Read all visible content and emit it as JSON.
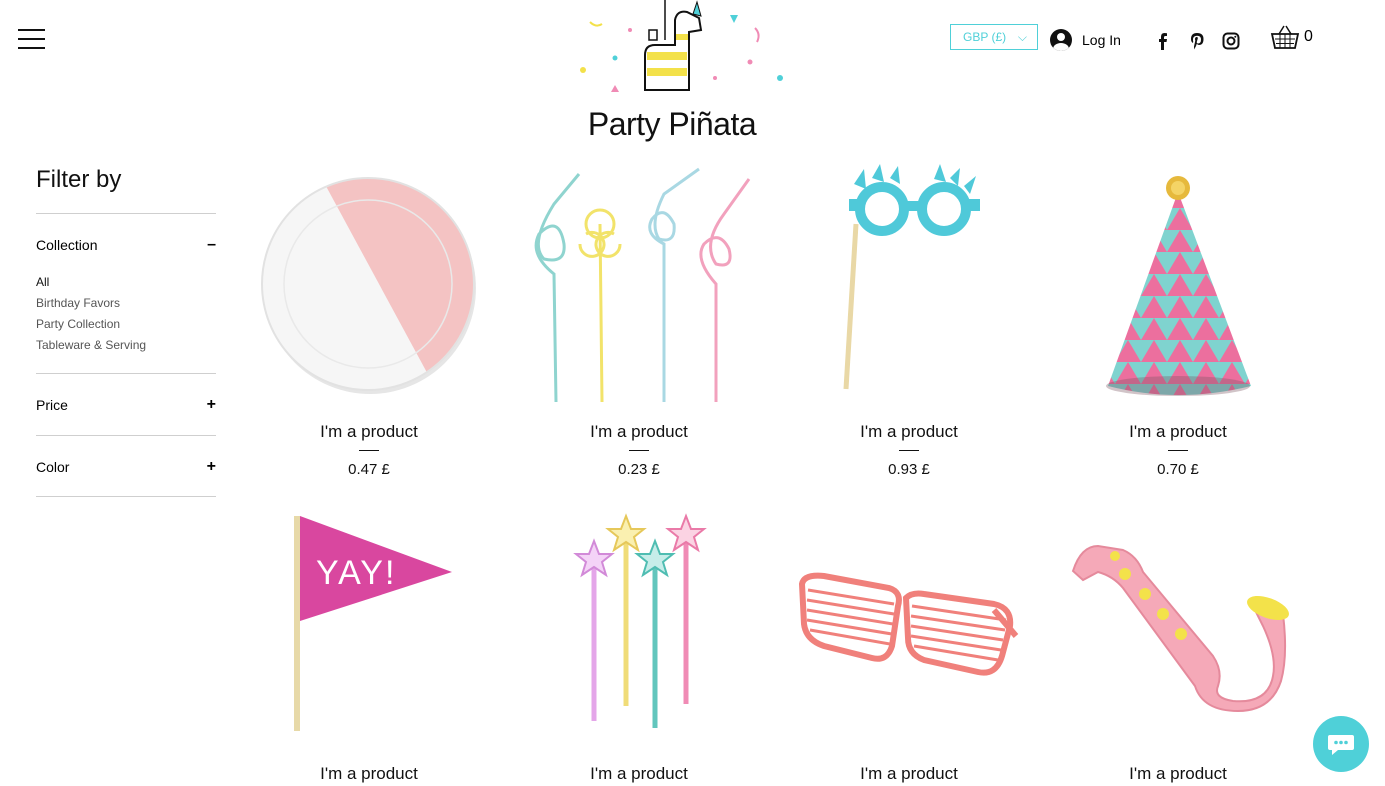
{
  "header": {
    "brand": "Party Piñata",
    "currency": "GBP (£)",
    "login": "Log In",
    "cart_count": "0",
    "social_icons": [
      "facebook-icon",
      "pinterest-icon",
      "instagram-icon"
    ],
    "accent_color": "#4fd0d8"
  },
  "sidebar": {
    "title": "Filter by",
    "collection": {
      "label": "Collection",
      "toggle": "–",
      "items": [
        "All",
        "Birthday Favors",
        "Party Collection",
        "Tableware & Serving"
      ]
    },
    "price": {
      "label": "Price",
      "toggle": "+"
    },
    "color": {
      "label": "Color",
      "toggle": "+"
    }
  },
  "products": [
    {
      "name": "I'm a product",
      "price": "0.47 £",
      "icon": "paper-plate"
    },
    {
      "name": "I'm a product",
      "price": "0.23 £",
      "icon": "curly-straws"
    },
    {
      "name": "I'm a product",
      "price": "0.93 £",
      "icon": "party-glasses-stick"
    },
    {
      "name": "I'm a product",
      "price": "0.70 £",
      "icon": "party-hat"
    },
    {
      "name": "I'm a product",
      "price": "",
      "icon": "yay-flag",
      "flag_text": "YAY!"
    },
    {
      "name": "I'm a product",
      "price": "",
      "icon": "star-wands"
    },
    {
      "name": "I'm a product",
      "price": "",
      "icon": "shutter-glasses"
    },
    {
      "name": "I'm a product",
      "price": "",
      "icon": "toy-saxophone"
    }
  ]
}
